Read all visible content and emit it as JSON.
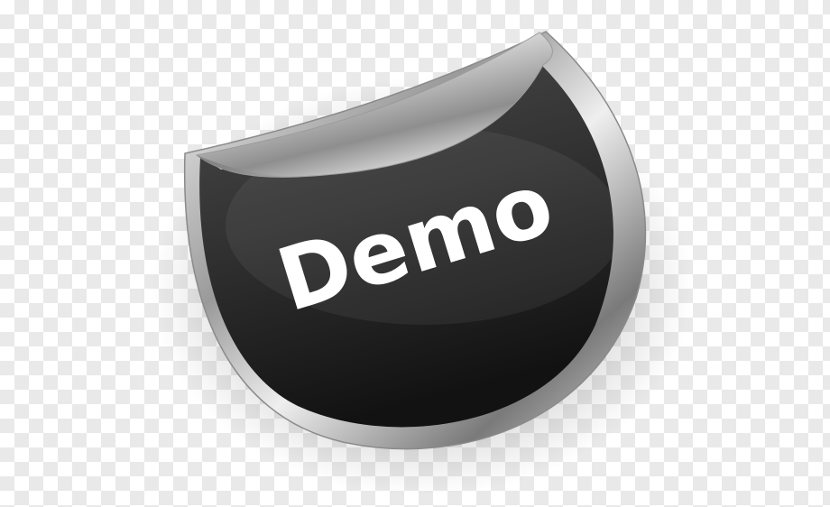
{
  "sticker": {
    "label": "Demo"
  },
  "colors": {
    "sticker_face": "#3a3a3a",
    "sticker_face_dark": "#161616",
    "rim_light": "#f2f2f2",
    "rim_dark": "#6e6e6e",
    "label_text": "#ffffff",
    "checker": "#e9e9e9"
  }
}
